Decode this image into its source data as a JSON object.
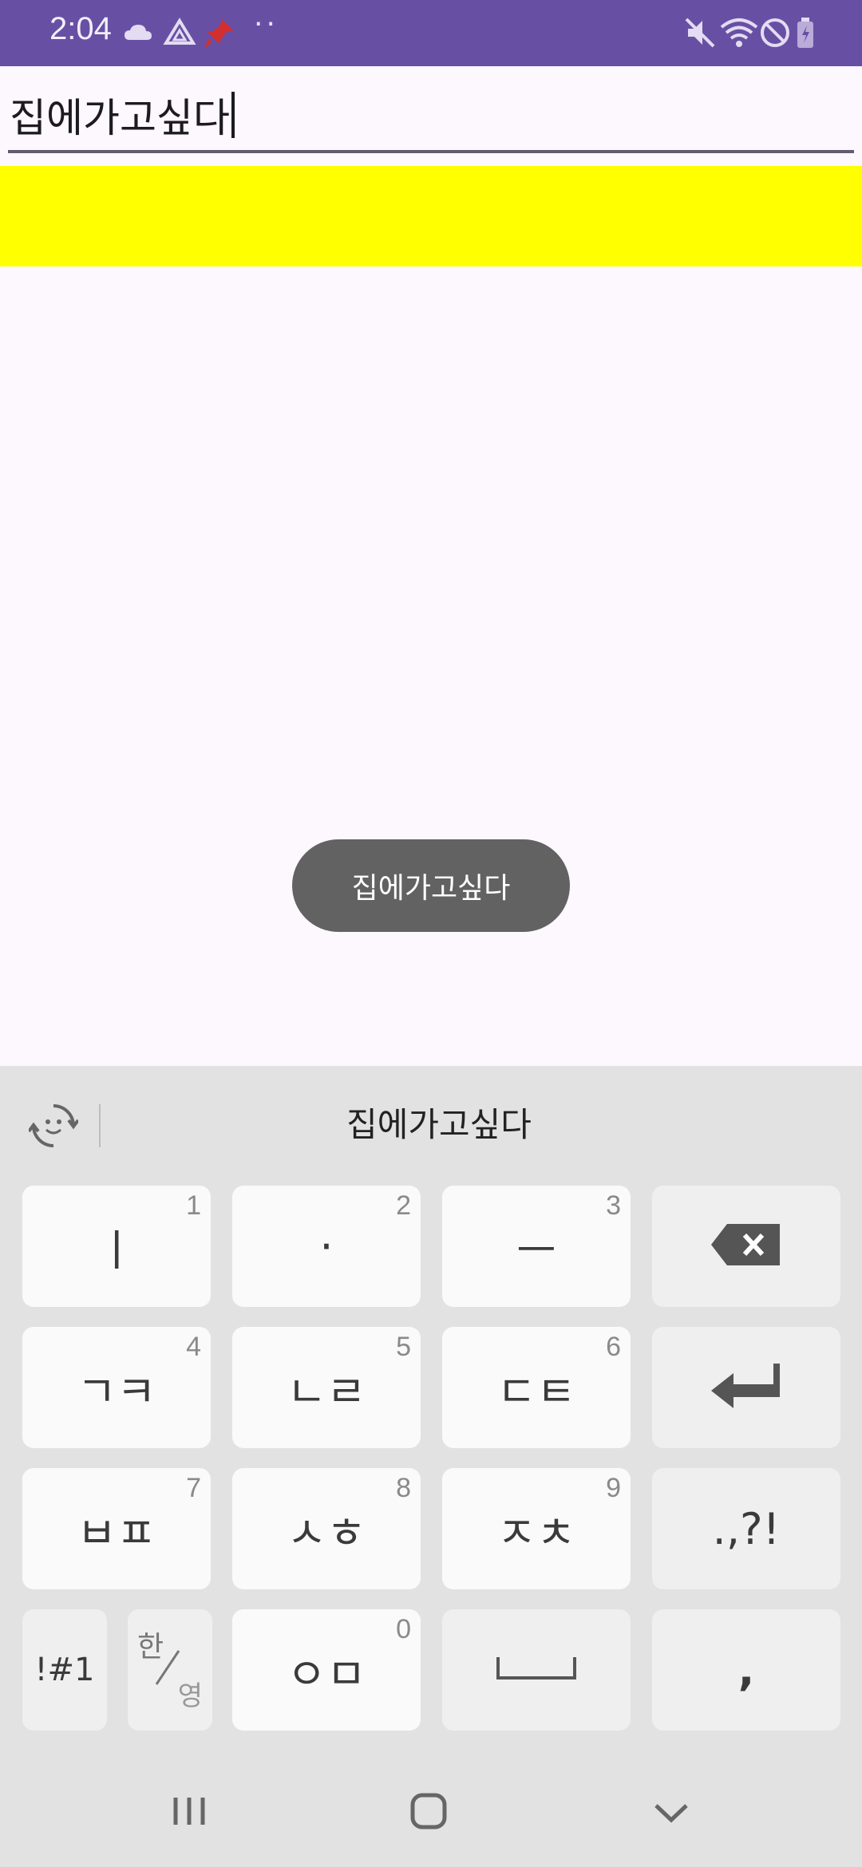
{
  "status_bar": {
    "time": "2:04",
    "left_icons": [
      "cloud-icon",
      "drive-icon",
      "pin-notification-icon"
    ],
    "more_dots": "··",
    "right_icons": [
      "mute-icon",
      "wifi-icon",
      "do-not-disturb-icon",
      "battery-icon"
    ],
    "bar_color": "#6750a4"
  },
  "text_field": {
    "value": "집에가고싶다"
  },
  "highlight_bar": {
    "color": "#ffff00"
  },
  "toast": {
    "text": "집에가고싶다"
  },
  "keyboard": {
    "refresh_icon": "refresh-emoji-icon",
    "suggestion": "집에가고싶다",
    "rows": [
      [
        {
          "label": "ㅣ",
          "num": "1"
        },
        {
          "label": "·",
          "num": "2"
        },
        {
          "label": "ㅡ",
          "num": "3"
        },
        {
          "icon": "backspace-icon"
        }
      ],
      [
        {
          "label": "ㄱㅋ",
          "num": "4"
        },
        {
          "label": "ㄴㄹ",
          "num": "5"
        },
        {
          "label": "ㄷㅌ",
          "num": "6"
        },
        {
          "icon": "enter-icon"
        }
      ],
      [
        {
          "label": "ㅂㅍ",
          "num": "7"
        },
        {
          "label": "ㅅㅎ",
          "num": "8"
        },
        {
          "label": "ㅈㅊ",
          "num": "9"
        },
        {
          "label": ".,?!"
        }
      ],
      [
        {
          "label": "!#1"
        },
        {
          "label_top": "한",
          "label_bottom": "영"
        },
        {
          "label": "ㅇㅁ",
          "num": "0"
        },
        {
          "icon": "space-icon"
        },
        {
          "label": ","
        }
      ]
    ]
  },
  "nav_bar": {
    "buttons": [
      "recents-icon",
      "home-icon",
      "back-icon"
    ]
  }
}
